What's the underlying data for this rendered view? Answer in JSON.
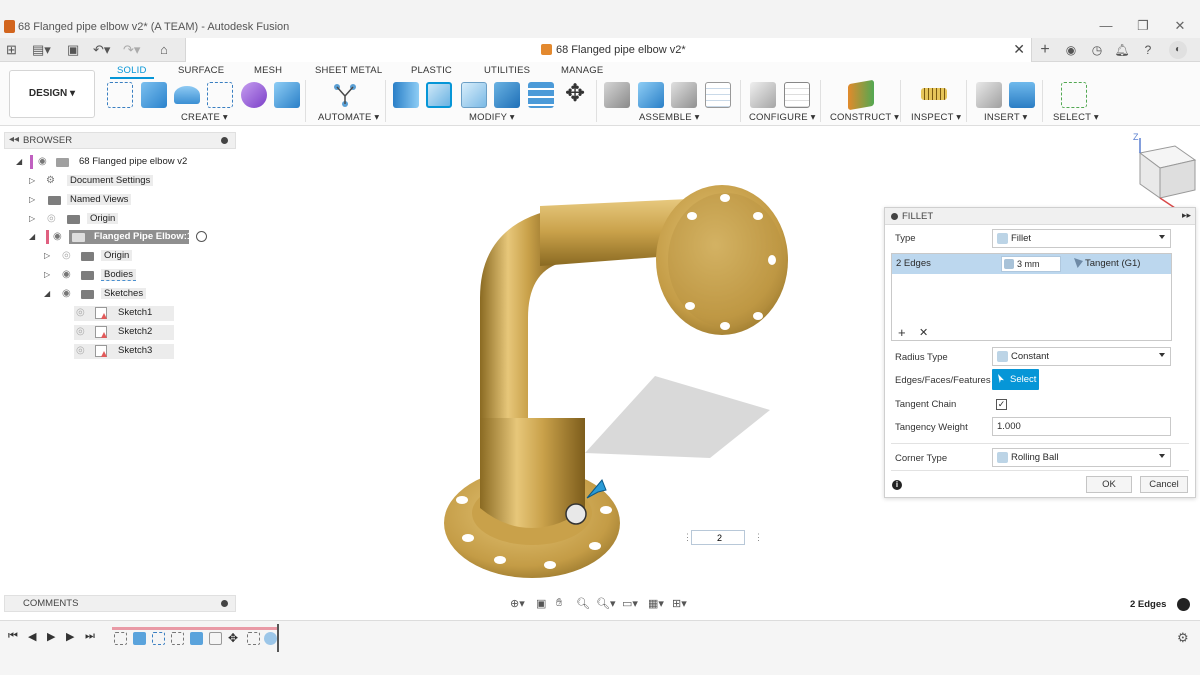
{
  "window": {
    "title": "68 Flanged pipe elbow v2* (A TEAM) - Autodesk Fusion",
    "minimize": "—",
    "maximize": "❐",
    "close": "✕"
  },
  "doc_tab": {
    "title": "68 Flanged pipe elbow v2*",
    "close": "✕"
  },
  "toolbar": {
    "workspace": "DESIGN ▾",
    "tabs": [
      "SOLID",
      "SURFACE",
      "MESH",
      "SHEET METAL",
      "PLASTIC",
      "UTILITIES",
      "MANAGE"
    ],
    "groups": [
      "CREATE ▾",
      "AUTOMATE ▾",
      "MODIFY ▾",
      "ASSEMBLE ▾",
      "CONFIGURE ▾",
      "CONSTRUCT ▾",
      "INSPECT ▾",
      "INSERT ▾",
      "SELECT ▾"
    ]
  },
  "browser": {
    "title": "BROWSER",
    "items": [
      {
        "label": "68 Flanged pipe elbow v2"
      },
      {
        "label": "Document Settings"
      },
      {
        "label": "Named Views"
      },
      {
        "label": "Origin"
      },
      {
        "label": "Flanged Pipe Elbow:1"
      },
      {
        "label": "Origin"
      },
      {
        "label": "Bodies"
      },
      {
        "label": "Sketches"
      },
      {
        "label": "Sketch1"
      },
      {
        "label": "Sketch2"
      },
      {
        "label": "Sketch3"
      }
    ]
  },
  "comments": {
    "title": "COMMENTS"
  },
  "fillet": {
    "title": "FILLET",
    "type_label": "Type",
    "type_value": "Fillet",
    "edges_count": "2 Edges",
    "radius": "3 mm",
    "continuity": "Tangent (G1)",
    "radius_type_label": "Radius Type",
    "radius_type_value": "Constant",
    "edges_faces_label": "Edges/Faces/Features",
    "select_label": "Select",
    "tangent_chain_label": "Tangent Chain",
    "tangent_chain_checked": true,
    "tangency_weight_label": "Tangency Weight",
    "tangency_weight_value": "1.000",
    "corner_type_label": "Corner Type",
    "corner_type_value": "Rolling Ball",
    "ok_label": "OK",
    "cancel_label": "Cancel"
  },
  "viewport": {
    "input_value": "2",
    "viewcube_faces": [
      "TOP",
      "FRONT",
      "RIGHT"
    ],
    "axis_z": "Z"
  },
  "status": {
    "selection": "2 Edges"
  },
  "colors": {
    "accent": "#0696d7",
    "brass": "#c9a14a",
    "selection_row": "#bcd7ee",
    "timeline_bar": "#e99aa6"
  }
}
